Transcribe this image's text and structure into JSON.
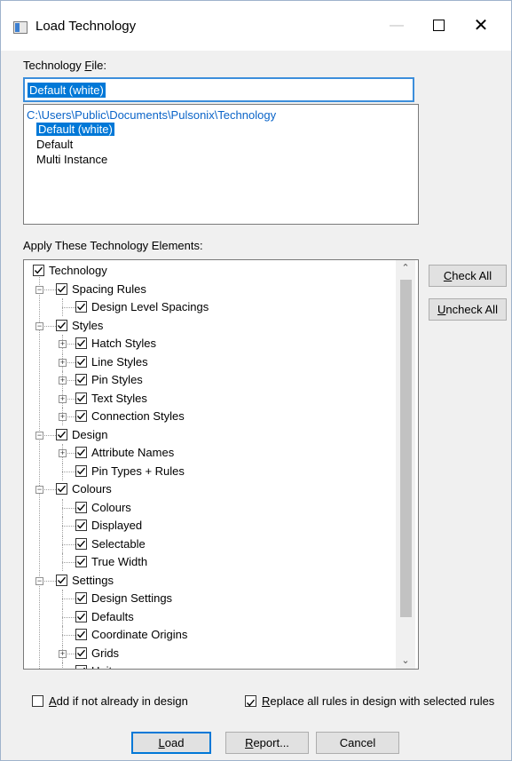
{
  "window": {
    "title": "Load Technology",
    "minimize_glyph": "—",
    "close_glyph": "✕"
  },
  "technology_file": {
    "label_prefix": "Technology ",
    "label_accel": "F",
    "label_suffix": "ile:",
    "input_value": "Default (white)",
    "folder_path": "C:\\Users\\Public\\Documents\\Pulsonix\\Technology",
    "files": [
      {
        "name": "Default (white)",
        "selected": true
      },
      {
        "name": "Default",
        "selected": false
      },
      {
        "name": "Multi Instance",
        "selected": false
      }
    ]
  },
  "elements": {
    "label": "Apply These Technology Elements:",
    "tree": [
      {
        "label": "Technology",
        "level": 0,
        "checked": true,
        "expander": "none"
      },
      {
        "label": "Spacing Rules",
        "level": 1,
        "checked": true,
        "expander": "minus"
      },
      {
        "label": "Design Level Spacings",
        "level": 2,
        "checked": true,
        "expander": "none"
      },
      {
        "label": "Styles",
        "level": 1,
        "checked": true,
        "expander": "minus"
      },
      {
        "label": "Hatch Styles",
        "level": 2,
        "checked": true,
        "expander": "plus"
      },
      {
        "label": "Line Styles",
        "level": 2,
        "checked": true,
        "expander": "plus"
      },
      {
        "label": "Pin Styles",
        "level": 2,
        "checked": true,
        "expander": "plus"
      },
      {
        "label": "Text Styles",
        "level": 2,
        "checked": true,
        "expander": "plus"
      },
      {
        "label": "Connection Styles",
        "level": 2,
        "checked": true,
        "expander": "plus"
      },
      {
        "label": "Design",
        "level": 1,
        "checked": true,
        "expander": "minus"
      },
      {
        "label": "Attribute Names",
        "level": 2,
        "checked": true,
        "expander": "plus"
      },
      {
        "label": "Pin Types + Rules",
        "level": 2,
        "checked": true,
        "expander": "none"
      },
      {
        "label": "Colours",
        "level": 1,
        "checked": true,
        "expander": "minus"
      },
      {
        "label": "Colours",
        "level": 2,
        "checked": true,
        "expander": "none"
      },
      {
        "label": "Displayed",
        "level": 2,
        "checked": true,
        "expander": "none"
      },
      {
        "label": "Selectable",
        "level": 2,
        "checked": true,
        "expander": "none"
      },
      {
        "label": "True Width",
        "level": 2,
        "checked": true,
        "expander": "none"
      },
      {
        "label": "Settings",
        "level": 1,
        "checked": true,
        "expander": "minus"
      },
      {
        "label": "Design Settings",
        "level": 2,
        "checked": true,
        "expander": "none"
      },
      {
        "label": "Defaults",
        "level": 2,
        "checked": true,
        "expander": "none"
      },
      {
        "label": "Coordinate Origins",
        "level": 2,
        "checked": true,
        "expander": "none"
      },
      {
        "label": "Grids",
        "level": 2,
        "checked": true,
        "expander": "plus"
      },
      {
        "label": "Units",
        "level": 2,
        "checked": true,
        "expander": "none"
      }
    ],
    "scroll_up_glyph": "⌃",
    "scroll_down_glyph": "⌄"
  },
  "side_buttons": {
    "check_all": {
      "accel": "C",
      "rest": "heck All"
    },
    "uncheck_all": {
      "accel": "U",
      "rest": "ncheck All"
    }
  },
  "options": {
    "add_if_missing": {
      "accel": "A",
      "rest": "dd if not already in design",
      "checked": false
    },
    "replace_rules": {
      "accel": "R",
      "rest": "eplace all rules in design with selected rules",
      "checked": true
    }
  },
  "footer_buttons": {
    "load": {
      "accel": "L",
      "rest": "oad"
    },
    "report": {
      "accel": "R",
      "rest": "eport..."
    },
    "cancel": {
      "label": "Cancel"
    }
  },
  "colors": {
    "accent": "#0078d7",
    "path_text": "#0a64c8",
    "input_border": "#3c8edb"
  }
}
